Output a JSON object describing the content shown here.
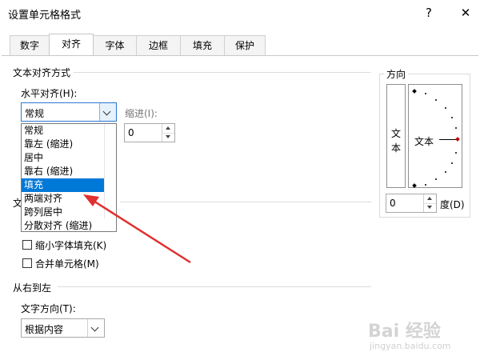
{
  "window": {
    "title": "设置单元格格式",
    "help_glyph": "?",
    "close_glyph": "✕"
  },
  "tabs": [
    {
      "label": "数字"
    },
    {
      "label": "对齐"
    },
    {
      "label": "字体"
    },
    {
      "label": "边框"
    },
    {
      "label": "填充"
    },
    {
      "label": "保护"
    }
  ],
  "active_tab": "对齐",
  "text_alignment": {
    "group_label": "文本对齐方式",
    "horizontal_label": "水平对齐(H):",
    "horizontal_value": "常规",
    "indent_label": "缩进(I):",
    "indent_value": "0",
    "dropdown_options": [
      "常规",
      "靠左 (缩进)",
      "居中",
      "靠右 (缩进)",
      "填充",
      "两端对齐",
      "跨列居中",
      "分散对齐 (缩进)"
    ],
    "selected_option": "填充"
  },
  "text_control": {
    "group_label_visible": "文",
    "shrink_label": "缩小字体填充(K)",
    "shrink_checked": false,
    "merge_label": "合并单元格(M)",
    "merge_checked": false
  },
  "rtl": {
    "group_label": "从右到左",
    "direction_label": "文字方向(T):",
    "direction_value": "根据内容"
  },
  "orientation": {
    "group_label": "方向",
    "vertical_text": [
      "文",
      "本"
    ],
    "dial_text": "文本",
    "degree_value": "0",
    "degree_label": "度(D)"
  },
  "colors": {
    "selection": "#0078d7",
    "arrow": "#e03030",
    "dial_marker": "#c00000"
  },
  "watermark": {
    "text": "Bai 经验",
    "sub": "jingyan.baidu.com"
  }
}
